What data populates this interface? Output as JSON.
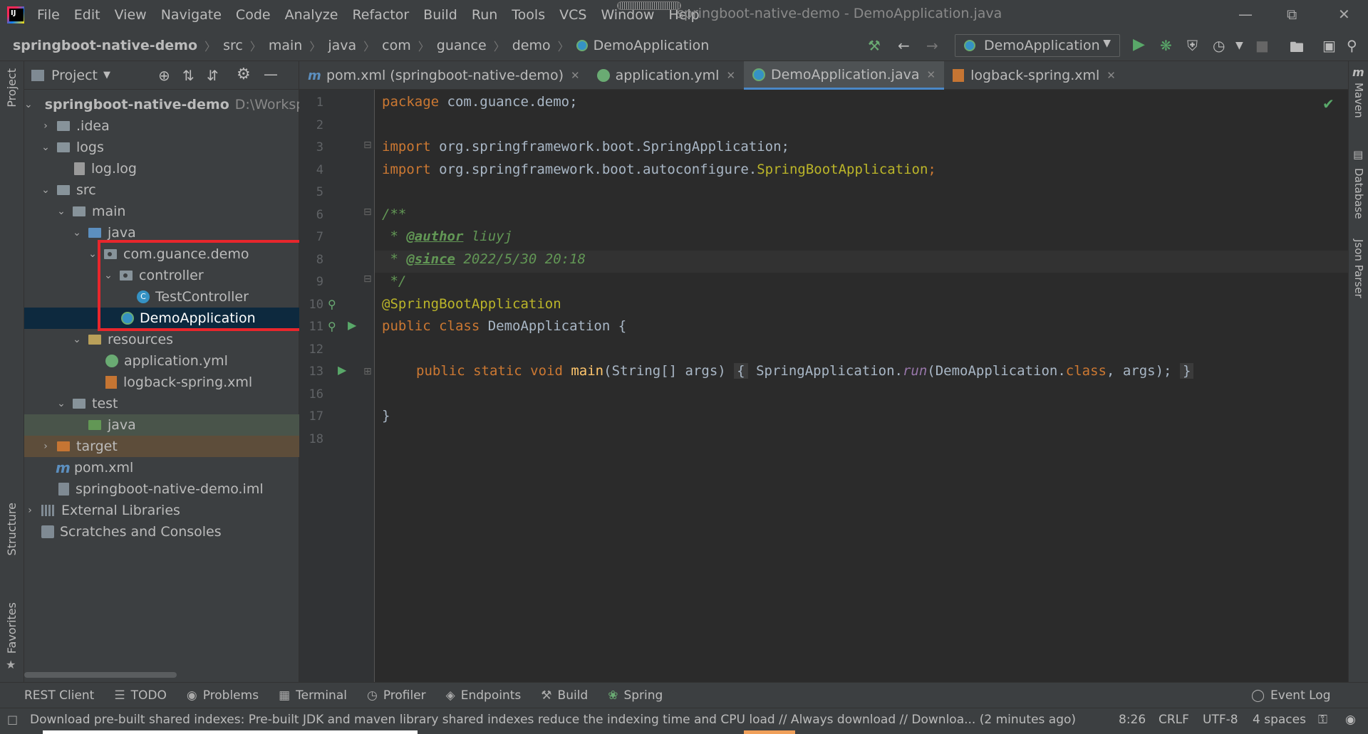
{
  "titlebar": {
    "menu": [
      "File",
      "Edit",
      "View",
      "Navigate",
      "Code",
      "Analyze",
      "Refactor",
      "Build",
      "Run",
      "Tools",
      "VCS",
      "Window",
      "Help"
    ],
    "title": "springboot-native-demo - DemoApplication.java"
  },
  "navbar": {
    "breadcrumbs": [
      "springboot-native-demo",
      "src",
      "main",
      "java",
      "com",
      "guance",
      "demo",
      "DemoApplication"
    ],
    "run_config": "DemoApplication"
  },
  "left_strip": {
    "project": "Project",
    "structure": "Structure",
    "favorites": "Favorites"
  },
  "right_strip": {
    "maven": "Maven",
    "database": "Database",
    "json_parser": "Json Parser"
  },
  "project_panel": {
    "title": "Project",
    "tree": [
      {
        "label": "springboot-native-demo",
        "extra": "D:\\Worksp"
      },
      {
        "label": ".idea"
      },
      {
        "label": "logs"
      },
      {
        "label": "log.log"
      },
      {
        "label": "src"
      },
      {
        "label": "main"
      },
      {
        "label": "java"
      },
      {
        "label": "com.guance.demo"
      },
      {
        "label": "controller"
      },
      {
        "label": "TestController"
      },
      {
        "label": "DemoApplication"
      },
      {
        "label": "resources"
      },
      {
        "label": "application.yml"
      },
      {
        "label": "logback-spring.xml"
      },
      {
        "label": "test"
      },
      {
        "label": "java"
      },
      {
        "label": "target"
      },
      {
        "label": "pom.xml"
      },
      {
        "label": "springboot-native-demo.iml"
      },
      {
        "label": "External Libraries"
      },
      {
        "label": "Scratches and Consoles"
      }
    ]
  },
  "tabs": [
    {
      "label": "pom.xml (springboot-native-demo)"
    },
    {
      "label": "application.yml"
    },
    {
      "label": "DemoApplication.java"
    },
    {
      "label": "logback-spring.xml"
    }
  ],
  "editor": {
    "line_numbers": [
      "1",
      "2",
      "3",
      "4",
      "5",
      "6",
      "7",
      "8",
      "9",
      "10",
      "11",
      "12",
      "13",
      "16",
      "17",
      "18"
    ],
    "code": {
      "l1_kw": "package",
      "l1_rest": " com.guance.demo;",
      "l3_kw": "import",
      "l3_rest": " org.springframework.boot.SpringApplication;",
      "l4_kw": "import",
      "l4_rest": " org.springframework.boot.autoconfigure.",
      "l4_cls": "SpringBootApplication",
      "l4_end": ";",
      "l6": "/**",
      "l7_pre": " * ",
      "l7_tag": "@author",
      "l7_rest": " liuyj",
      "l8_pre": " * ",
      "l8_tag": "@since",
      "l8_rest": " 2022/5/30 20:18",
      "l9": " */",
      "l10": "@SpringBootApplication",
      "l11_kw": "public class",
      "l11_rest": " DemoApplication {",
      "l13_kw": "public static void",
      "l13_fn": "main",
      "l13_args": "(String[] args)",
      "l13_open": "{",
      "l13_body1": " SpringApplication.",
      "l13_run": "run",
      "l13_body2": "(DemoApplication.",
      "l13_class": "class",
      "l13_body3": ", args);",
      "l13_close": "}",
      "l17": "}"
    }
  },
  "bottom_tools": [
    {
      "label": "REST Client"
    },
    {
      "label": "TODO"
    },
    {
      "label": "Problems"
    },
    {
      "label": "Terminal"
    },
    {
      "label": "Profiler"
    },
    {
      "label": "Endpoints"
    },
    {
      "label": "Build"
    },
    {
      "label": "Spring"
    }
  ],
  "event_log": "Event Log",
  "status": {
    "message": "Download pre-built shared indexes: Pre-built JDK and maven library shared indexes reduce the indexing time and CPU load // Always download // Downloa... (2 minutes ago)",
    "position": "8:26",
    "line_sep": "CRLF",
    "encoding": "UTF-8",
    "indent": "4 spaces"
  },
  "colors": {
    "highlight": "#e8262c",
    "accent": "#4a88c7",
    "selected_row": "#0d293e"
  }
}
